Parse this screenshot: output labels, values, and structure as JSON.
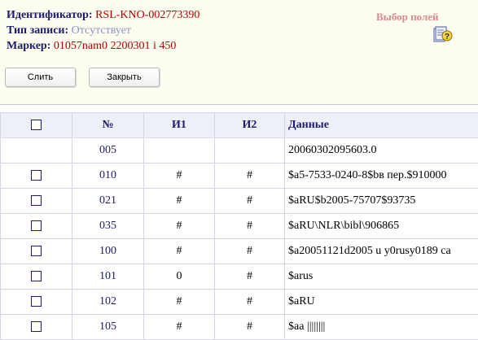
{
  "record": {
    "id_label": "Идентификатор:",
    "id_value": "RSL-KNO-002773390",
    "type_label": "Тип записи:",
    "type_value": "Отсутствует",
    "marker_label": "Маркер:",
    "marker_value": "01057nam0 2200301 i 450"
  },
  "field_select": {
    "label": "Выбор полей",
    "icon": "help-icon"
  },
  "buttons": {
    "merge": "Слить",
    "close": "Закрыть"
  },
  "table": {
    "headers": {
      "num": "№",
      "i1": "И1",
      "i2": "И2",
      "data": "Данные"
    },
    "rows": [
      {
        "tag": "005",
        "i1": "",
        "i2": "",
        "data": "20060302095603.0",
        "checkbox": false
      },
      {
        "tag": "010",
        "i1": "#",
        "i2": "#",
        "data": "$a5-7533-0240-8$bв пер.$910000",
        "checkbox": true
      },
      {
        "tag": "021",
        "i1": "#",
        "i2": "#",
        "data": "$aRU$b2005-75707$93735",
        "checkbox": true
      },
      {
        "tag": "035",
        "i1": "#",
        "i2": "#",
        "data": "$aRU\\NLR\\bibl\\906865",
        "checkbox": true
      },
      {
        "tag": "100",
        "i1": "#",
        "i2": "#",
        "data": "$a20051121d2005 u y0rusy0189 ca",
        "checkbox": true
      },
      {
        "tag": "101",
        "i1": "0",
        "i2": "#",
        "data": "$arus",
        "checkbox": true
      },
      {
        "tag": "102",
        "i1": "#",
        "i2": "#",
        "data": "$aRU",
        "checkbox": true
      },
      {
        "tag": "105",
        "i1": "#",
        "i2": "#",
        "data": "$aa ||||||||",
        "checkbox": true
      }
    ]
  }
}
